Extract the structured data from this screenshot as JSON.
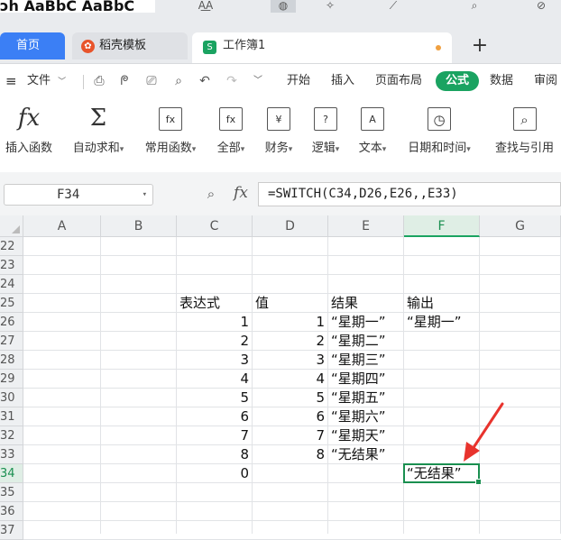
{
  "top": {
    "styles_preview": "ɔh AaBbC AaBbC"
  },
  "tabs": [
    {
      "label": "首页"
    },
    {
      "label": "稻壳模板",
      "icon": "docer-icon"
    },
    {
      "label": "工作簿1",
      "icon": "spreadsheet-icon"
    }
  ],
  "new_tab": "+",
  "menu": {
    "hamburger": "≡",
    "file": "文件",
    "items": [
      "开始",
      "插入",
      "页面布局",
      "公式",
      "数据",
      "审阅"
    ],
    "active": "公式"
  },
  "ribbon": [
    {
      "label": "插入函数",
      "icon": "fx-icon",
      "glyph": "fx"
    },
    {
      "label": "自动求和",
      "icon": "sigma-icon",
      "glyph": "Σ",
      "dropdown": true
    },
    {
      "label": "常用函数",
      "icon": "star-fx-icon",
      "glyph": "fx",
      "dropdown": true
    },
    {
      "label": "全部",
      "icon": "all-fx-icon",
      "glyph": "fx",
      "dropdown": true
    },
    {
      "label": "财务",
      "icon": "yen-icon",
      "glyph": "¥",
      "dropdown": true
    },
    {
      "label": "逻辑",
      "icon": "question-icon",
      "glyph": "?",
      "dropdown": true
    },
    {
      "label": "文本",
      "icon": "text-a-icon",
      "glyph": "A",
      "dropdown": true
    },
    {
      "label": "日期和时间",
      "icon": "clock-icon",
      "glyph": "◷",
      "dropdown": true
    },
    {
      "label": "查找与引用",
      "icon": "lookup-icon",
      "glyph": "⌕",
      "dropdown": true
    }
  ],
  "formula_bar": {
    "cell_ref": "F34",
    "fx": "fx",
    "formula": "=SWITCH(C34,D26,E26,,E33)"
  },
  "grid": {
    "columns": [
      "A",
      "B",
      "C",
      "D",
      "E",
      "F",
      "G"
    ],
    "selected_column": "F",
    "rows": [
      "22",
      "23",
      "24",
      "25",
      "26",
      "27",
      "28",
      "29",
      "30",
      "31",
      "32",
      "33",
      "34",
      "35",
      "36",
      "37"
    ],
    "selected_row": "34",
    "cells": {
      "C25": "表达式",
      "D25": "值",
      "E25": "结果",
      "F25": "输出",
      "C26": "1",
      "D26": "1",
      "E26": "“星期一”",
      "F26": "“星期一”",
      "C27": "2",
      "D27": "2",
      "E27": "“星期二”",
      "C28": "3",
      "D28": "3",
      "E28": "“星期三”",
      "C29": "4",
      "D29": "4",
      "E29": "“星期四”",
      "C30": "5",
      "D30": "5",
      "E30": "“星期五”",
      "C31": "6",
      "D31": "6",
      "E31": "“星期六”",
      "C32": "7",
      "D32": "7",
      "E32": "“星期天”",
      "C33": "8",
      "D33": "8",
      "E33": "“无结果”",
      "C34": "0",
      "F34": "“无结果”"
    },
    "annotation_color": "#e8332d"
  }
}
